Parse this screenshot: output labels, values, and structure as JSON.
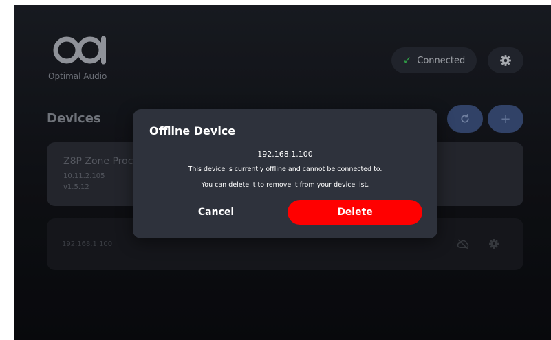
{
  "header": {
    "brand": "Optimal Audio",
    "logo_icon": "oa-logo-icon",
    "status_label": "Connected",
    "status_icon": "check-icon",
    "settings_icon": "gear-icon"
  },
  "devices": {
    "title": "Devices",
    "refresh_icon": "refresh-icon",
    "add_icon": "plus-icon",
    "add_glyph": "+",
    "items": [
      {
        "name": "Z8P Zone Proce",
        "ip": "10.11.2.105",
        "version": "v1.5.12"
      },
      {
        "ip": "192.168.1.100",
        "status_icon": "cloud-offline-icon",
        "settings_icon": "gear-icon"
      }
    ]
  },
  "modal": {
    "title": "Offline Device",
    "ip": "192.168.1.100",
    "line1": "This device is currently offline and cannot be connected to.",
    "line2": "You can delete it to remove it from your device list.",
    "cancel_label": "Cancel",
    "delete_label": "Delete"
  },
  "colors": {
    "accent_delete": "#ff0000",
    "status_ok": "#3ecf5c",
    "button_blue": "#3f5585",
    "modal_bg": "#2e323c"
  }
}
